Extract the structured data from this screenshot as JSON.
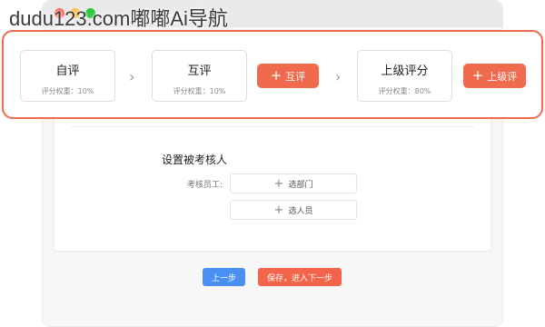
{
  "watermark": "dudu123.com嘟嘟Ai导航",
  "flow": {
    "steps": [
      {
        "name": "自评",
        "weight": "评分权重：10%"
      },
      {
        "name": "互评",
        "weight": "评分权重：10%"
      },
      {
        "name": "上级评分",
        "weight": "评分权重：80%"
      }
    ],
    "add_peer_label": "互评",
    "add_superior_label": "上级评"
  },
  "reviewee": {
    "title": "设置被考核人",
    "employee_label": "考核员工:",
    "select_dept_label": "选部门",
    "select_person_label": "选人员"
  },
  "footer": {
    "prev_label": "上一步",
    "save_label": "保存，进入下一步"
  },
  "colors": {
    "accent": "#f06a4e",
    "primary": "#4a90f2"
  }
}
